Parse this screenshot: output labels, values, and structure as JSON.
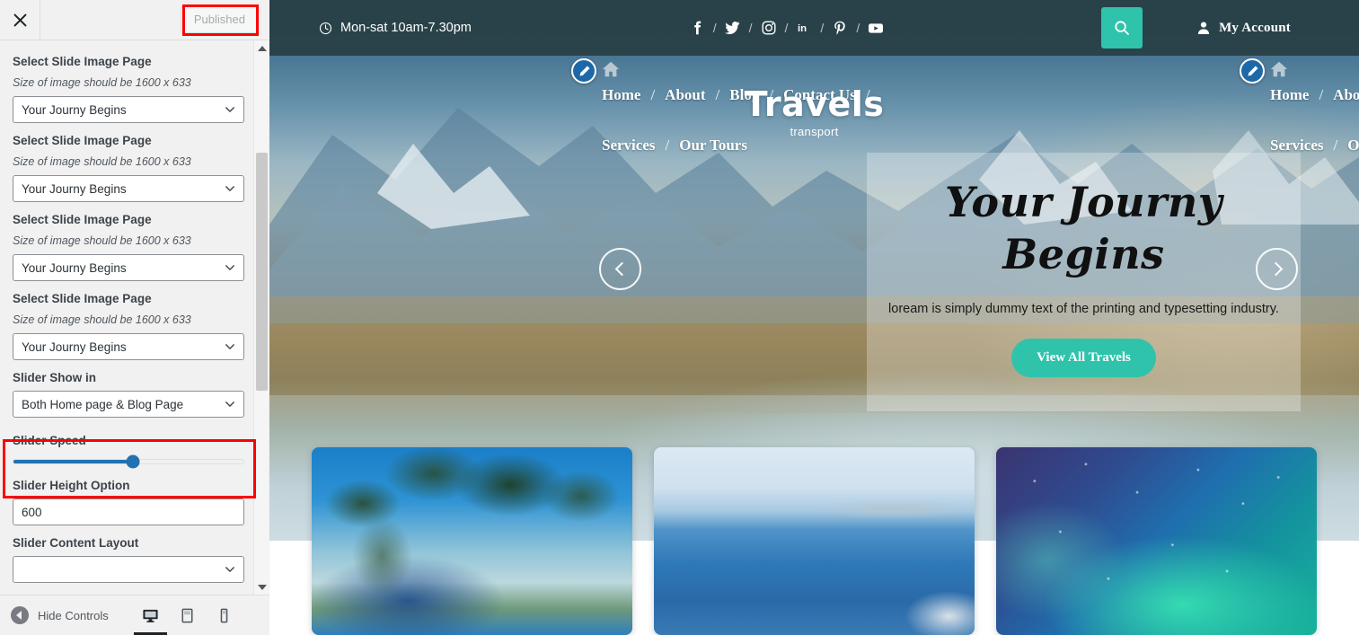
{
  "customizer": {
    "close_icon": "close-icon",
    "publish_button_label": "Published",
    "hide_controls_label": "Hide Controls",
    "devices": [
      {
        "name": "desktop",
        "icon": "desktop-icon",
        "active": true
      },
      {
        "name": "tablet",
        "icon": "tablet-icon",
        "active": false
      },
      {
        "name": "mobile",
        "icon": "mobile-icon",
        "active": false
      }
    ],
    "highlight_color": "#ff0000",
    "controls": [
      {
        "label": "Select Slide Image Page",
        "desc": "Size of image should be 1600 x 633",
        "value": "Your Journy Begins",
        "type": "select"
      },
      {
        "label": "Select Slide Image Page",
        "desc": "Size of image should be 1600 x 633",
        "value": "Your Journy Begins",
        "type": "select"
      },
      {
        "label": "Select Slide Image Page",
        "desc": "Size of image should be 1600 x 633",
        "value": "Your Journy Begins",
        "type": "select"
      },
      {
        "label": "Select Slide Image Page",
        "desc": "Size of image should be 1600 x 633",
        "value": "Your Journy Begins",
        "type": "select"
      },
      {
        "label": "Slider Show in",
        "desc": "",
        "value": "Both Home page & Blog Page",
        "type": "select"
      },
      {
        "label": "Slider Speed",
        "desc": "",
        "value": "52",
        "type": "range"
      },
      {
        "label": "Slider Height Option",
        "desc": "",
        "value": "600",
        "type": "text"
      },
      {
        "label": "Slider Content Layout",
        "desc": "",
        "value": "",
        "type": "select"
      }
    ],
    "slider_speed_percent": 52
  },
  "preview": {
    "topbar": {
      "clock_icon": "clock-icon",
      "hours": "Mon-sat 10am-7.30pm",
      "social": [
        {
          "name": "facebook-icon",
          "glyph": "f"
        },
        {
          "name": "twitter-icon",
          "glyph": "t"
        },
        {
          "name": "instagram-icon",
          "glyph": "ig"
        },
        {
          "name": "linkedin-icon",
          "glyph": "in"
        },
        {
          "name": "pinterest-icon",
          "glyph": "p"
        },
        {
          "name": "youtube-icon",
          "glyph": "yt"
        }
      ],
      "separator": "/",
      "search_icon": "search-icon",
      "search_button_color": "#2fc3ac",
      "account_icon": "user-icon",
      "account_label": "My Account"
    },
    "nav": {
      "edit_icon": "edit-pencil-icon",
      "home_icon": "home-icon",
      "separator": "/",
      "row1": [
        "Home",
        "About",
        "Blog",
        "Contact Us"
      ],
      "row2": [
        "Services",
        "Our Tours"
      ]
    },
    "logo": {
      "title": "Travels",
      "subtitle": "transport"
    },
    "hero": {
      "title_line1": "Your Journy",
      "title_line2": "Begins",
      "subtitle": "loream is simply dummy text of the printing and typesetting industry.",
      "cta_label": "View All Travels",
      "cta_color": "#2fc3ac",
      "prev_icon": "chevron-left-icon",
      "next_icon": "chevron-right-icon"
    },
    "cards": [
      {
        "name": "tour-card-palm-beach"
      },
      {
        "name": "tour-card-coastline"
      },
      {
        "name": "tour-card-aurora"
      }
    ]
  }
}
